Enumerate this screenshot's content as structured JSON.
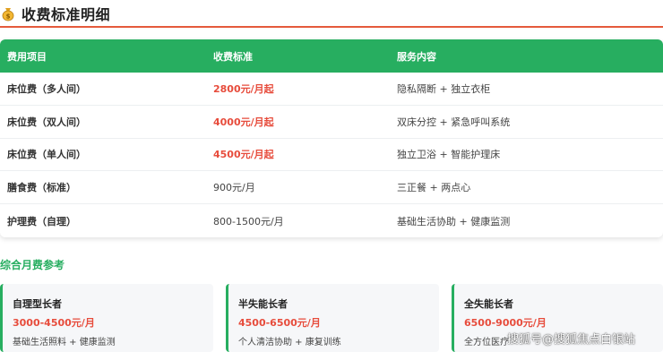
{
  "section_title": "收费标准明细",
  "table": {
    "headers": [
      "费用项目",
      "收费标准",
      "服务内容"
    ],
    "rows": [
      {
        "item": "床位费（多人间）",
        "price": "2800元/月起",
        "service": "隐私隔断 + 独立衣柜",
        "highlight": true
      },
      {
        "item": "床位费（双人间）",
        "price": "4000元/月起",
        "service": "双床分控 + 紧急呼叫系统",
        "highlight": true
      },
      {
        "item": "床位费（单人间）",
        "price": "4500元/月起",
        "service": "独立卫浴 + 智能护理床",
        "highlight": true
      },
      {
        "item": "膳食费（标准）",
        "price": "900元/月",
        "service": "三正餐 + 两点心",
        "highlight": false
      },
      {
        "item": "护理费（自理）",
        "price": "800-1500元/月",
        "service": "基础生活协助 + 健康监测",
        "highlight": false
      }
    ]
  },
  "monthly_section_title": "综合月费参考",
  "cards": [
    {
      "title": "自理型长者",
      "price": "3000-4500元/月",
      "desc": "基础生活照料 + 健康监测"
    },
    {
      "title": "半失能长者",
      "price": "4500-6500元/月",
      "desc": "个人清洁协助 + 康复训练"
    },
    {
      "title": "全失能长者",
      "price": "6500-9000元/月",
      "desc": "全方位医疗"
    }
  ],
  "watermark": "搜狐号@搜狐焦点白银站",
  "colors": {
    "accent": "#27ae60",
    "price": "#e74c3c",
    "title_line": "#e55a3c"
  },
  "icons": {
    "title_icon": "money-bag-icon"
  }
}
